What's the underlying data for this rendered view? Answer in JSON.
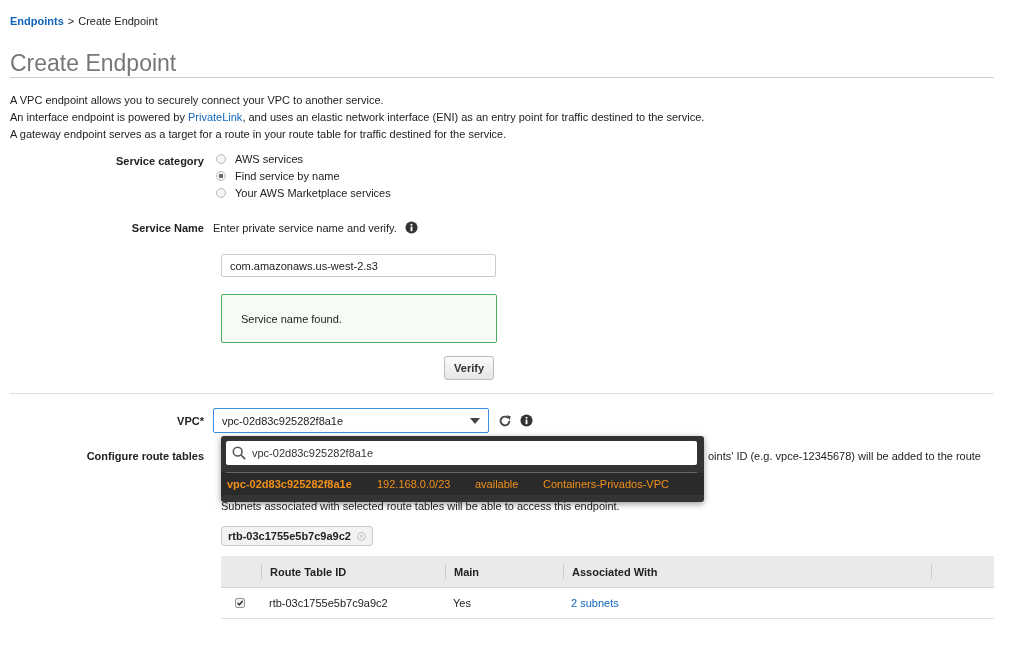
{
  "breadcrumb": {
    "link": "Endpoints",
    "separator": ">",
    "current": "Create Endpoint"
  },
  "title": "Create Endpoint",
  "intro": [
    {
      "text": "A VPC endpoint allows you to securely connect your VPC to another service."
    },
    {
      "text": "An interface endpoint is powered by ",
      "link": "PrivateLink",
      "after": ", and uses an elastic network interface (ENI) as an entry point for traffic destined to the service."
    },
    {
      "text": "A gateway endpoint serves as a target for a route in your route table for traffic destined for the service."
    }
  ],
  "service_category": {
    "label": "Service category",
    "options": [
      {
        "label": "AWS services",
        "selected": false
      },
      {
        "label": "Find service by name",
        "selected": true
      },
      {
        "label": "Your AWS Marketplace services",
        "selected": false
      }
    ]
  },
  "service_name": {
    "label": "Service Name",
    "hint": "Enter private service name and verify.",
    "value": "com.amazonaws.us-west-2.s3",
    "message": "Service name found.",
    "verify_button": "Verify"
  },
  "vpc": {
    "label": "VPC*",
    "value": "vpc-02d83c925282f8a1e",
    "dropdown": {
      "expanded": true,
      "search_value": "vpc-02d83c925282f8a1e",
      "options": [
        {
          "id": "vpc-02d83c925282f8a1e",
          "cidr": "192.168.0.0/23",
          "state": "available",
          "name": "Containers-Privados-VPC",
          "selected": true
        }
      ]
    }
  },
  "route_tables": {
    "label": "Configure route tables",
    "note": "oints' ID (e.g. vpce-12345678) will be added to the route",
    "subnets_note": "Subnets associated with selected route tables will be able to access this endpoint.",
    "tags": [
      "rtb-03c1755e5b7c9a9c2"
    ],
    "columns": [
      "Route Table ID",
      "Main",
      "Associated With"
    ],
    "rows": [
      {
        "checked": true,
        "id": "rtb-03c1755e5b7c9a9c2",
        "main": "Yes",
        "associated": "2 subnets"
      }
    ]
  }
}
